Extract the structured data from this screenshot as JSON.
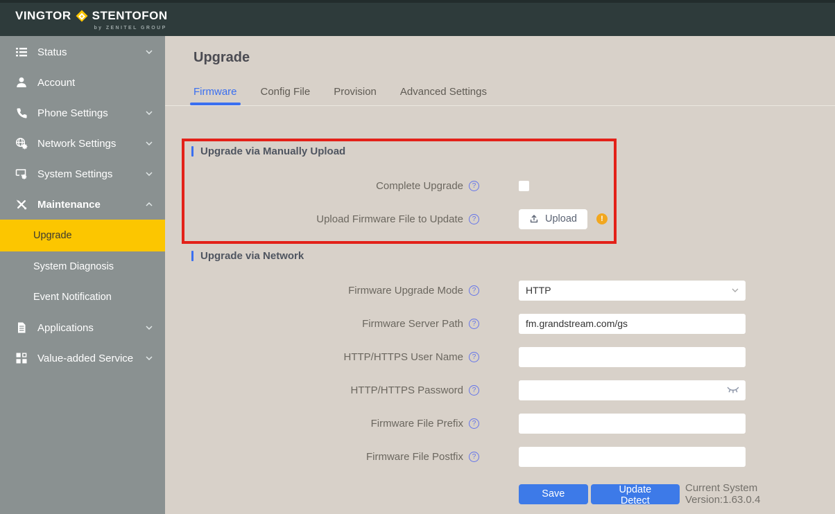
{
  "colors": {
    "topbar_bg": "#2e3b3b",
    "sidebar_bg": "#8a9191",
    "content_bg": "#d8d1c9",
    "brand_yellow": "#fcc600",
    "accent_blue": "#3a6ff0",
    "button_blue": "#3d7ae8",
    "annotation_red": "#e32119",
    "warning_orange": "#f2a71e",
    "help_icon_blue": "#6374ea"
  },
  "brand": {
    "name_left": "VINGTOR",
    "name_right": "STENTOFON",
    "tagline": "by ZENITEL GROUP"
  },
  "sidebar": {
    "items": [
      {
        "label": "Status",
        "icon": "status-list-icon",
        "chevron": "down"
      },
      {
        "label": "Account",
        "icon": "account-user-icon",
        "chevron": "none"
      },
      {
        "label": "Phone Settings",
        "icon": "phone-icon",
        "chevron": "down"
      },
      {
        "label": "Network Settings",
        "icon": "network-globe-gear-icon",
        "chevron": "down"
      },
      {
        "label": "System Settings",
        "icon": "system-monitor-gear-icon",
        "chevron": "down"
      },
      {
        "label": "Maintenance",
        "icon": "maintenance-tools-icon",
        "chevron": "up",
        "expanded": true
      },
      {
        "label": "Applications",
        "icon": "applications-document-icon",
        "chevron": "down"
      },
      {
        "label": "Value-added Service",
        "icon": "value-added-grid-icon",
        "chevron": "down"
      }
    ],
    "maintenance_subitems": [
      {
        "label": "Upgrade",
        "selected": true
      },
      {
        "label": "System Diagnosis",
        "selected": false
      },
      {
        "label": "Event Notification",
        "selected": false
      }
    ]
  },
  "page": {
    "title": "Upgrade",
    "tabs": [
      {
        "label": "Firmware",
        "active": true
      },
      {
        "label": "Config File",
        "active": false
      },
      {
        "label": "Provision",
        "active": false
      },
      {
        "label": "Advanced Settings",
        "active": false
      }
    ]
  },
  "manual_section": {
    "title": "Upgrade via Manually Upload",
    "complete_upgrade_label": "Complete Upgrade",
    "complete_upgrade_checked": false,
    "upload_label": "Upload Firmware File to Update",
    "upload_button_label": "Upload",
    "upload_warning": true
  },
  "network_section": {
    "title": "Upgrade via Network",
    "fields": [
      {
        "label": "Firmware Upgrade Mode",
        "type": "select",
        "value": "HTTP"
      },
      {
        "label": "Firmware Server Path",
        "type": "text",
        "value": "fm.grandstream.com/gs"
      },
      {
        "label": "HTTP/HTTPS User Name",
        "type": "text",
        "value": ""
      },
      {
        "label": "HTTP/HTTPS Password",
        "type": "password",
        "value": ""
      },
      {
        "label": "Firmware File Prefix",
        "type": "text",
        "value": ""
      },
      {
        "label": "Firmware File Postfix",
        "type": "text",
        "value": ""
      }
    ]
  },
  "footer": {
    "save_label": "Save",
    "update_detect_label": "Update Detect",
    "version_text": "Current System Version:1.63.0.4"
  },
  "annotation": {
    "type": "highlight-rectangle",
    "color": "#e32119"
  }
}
